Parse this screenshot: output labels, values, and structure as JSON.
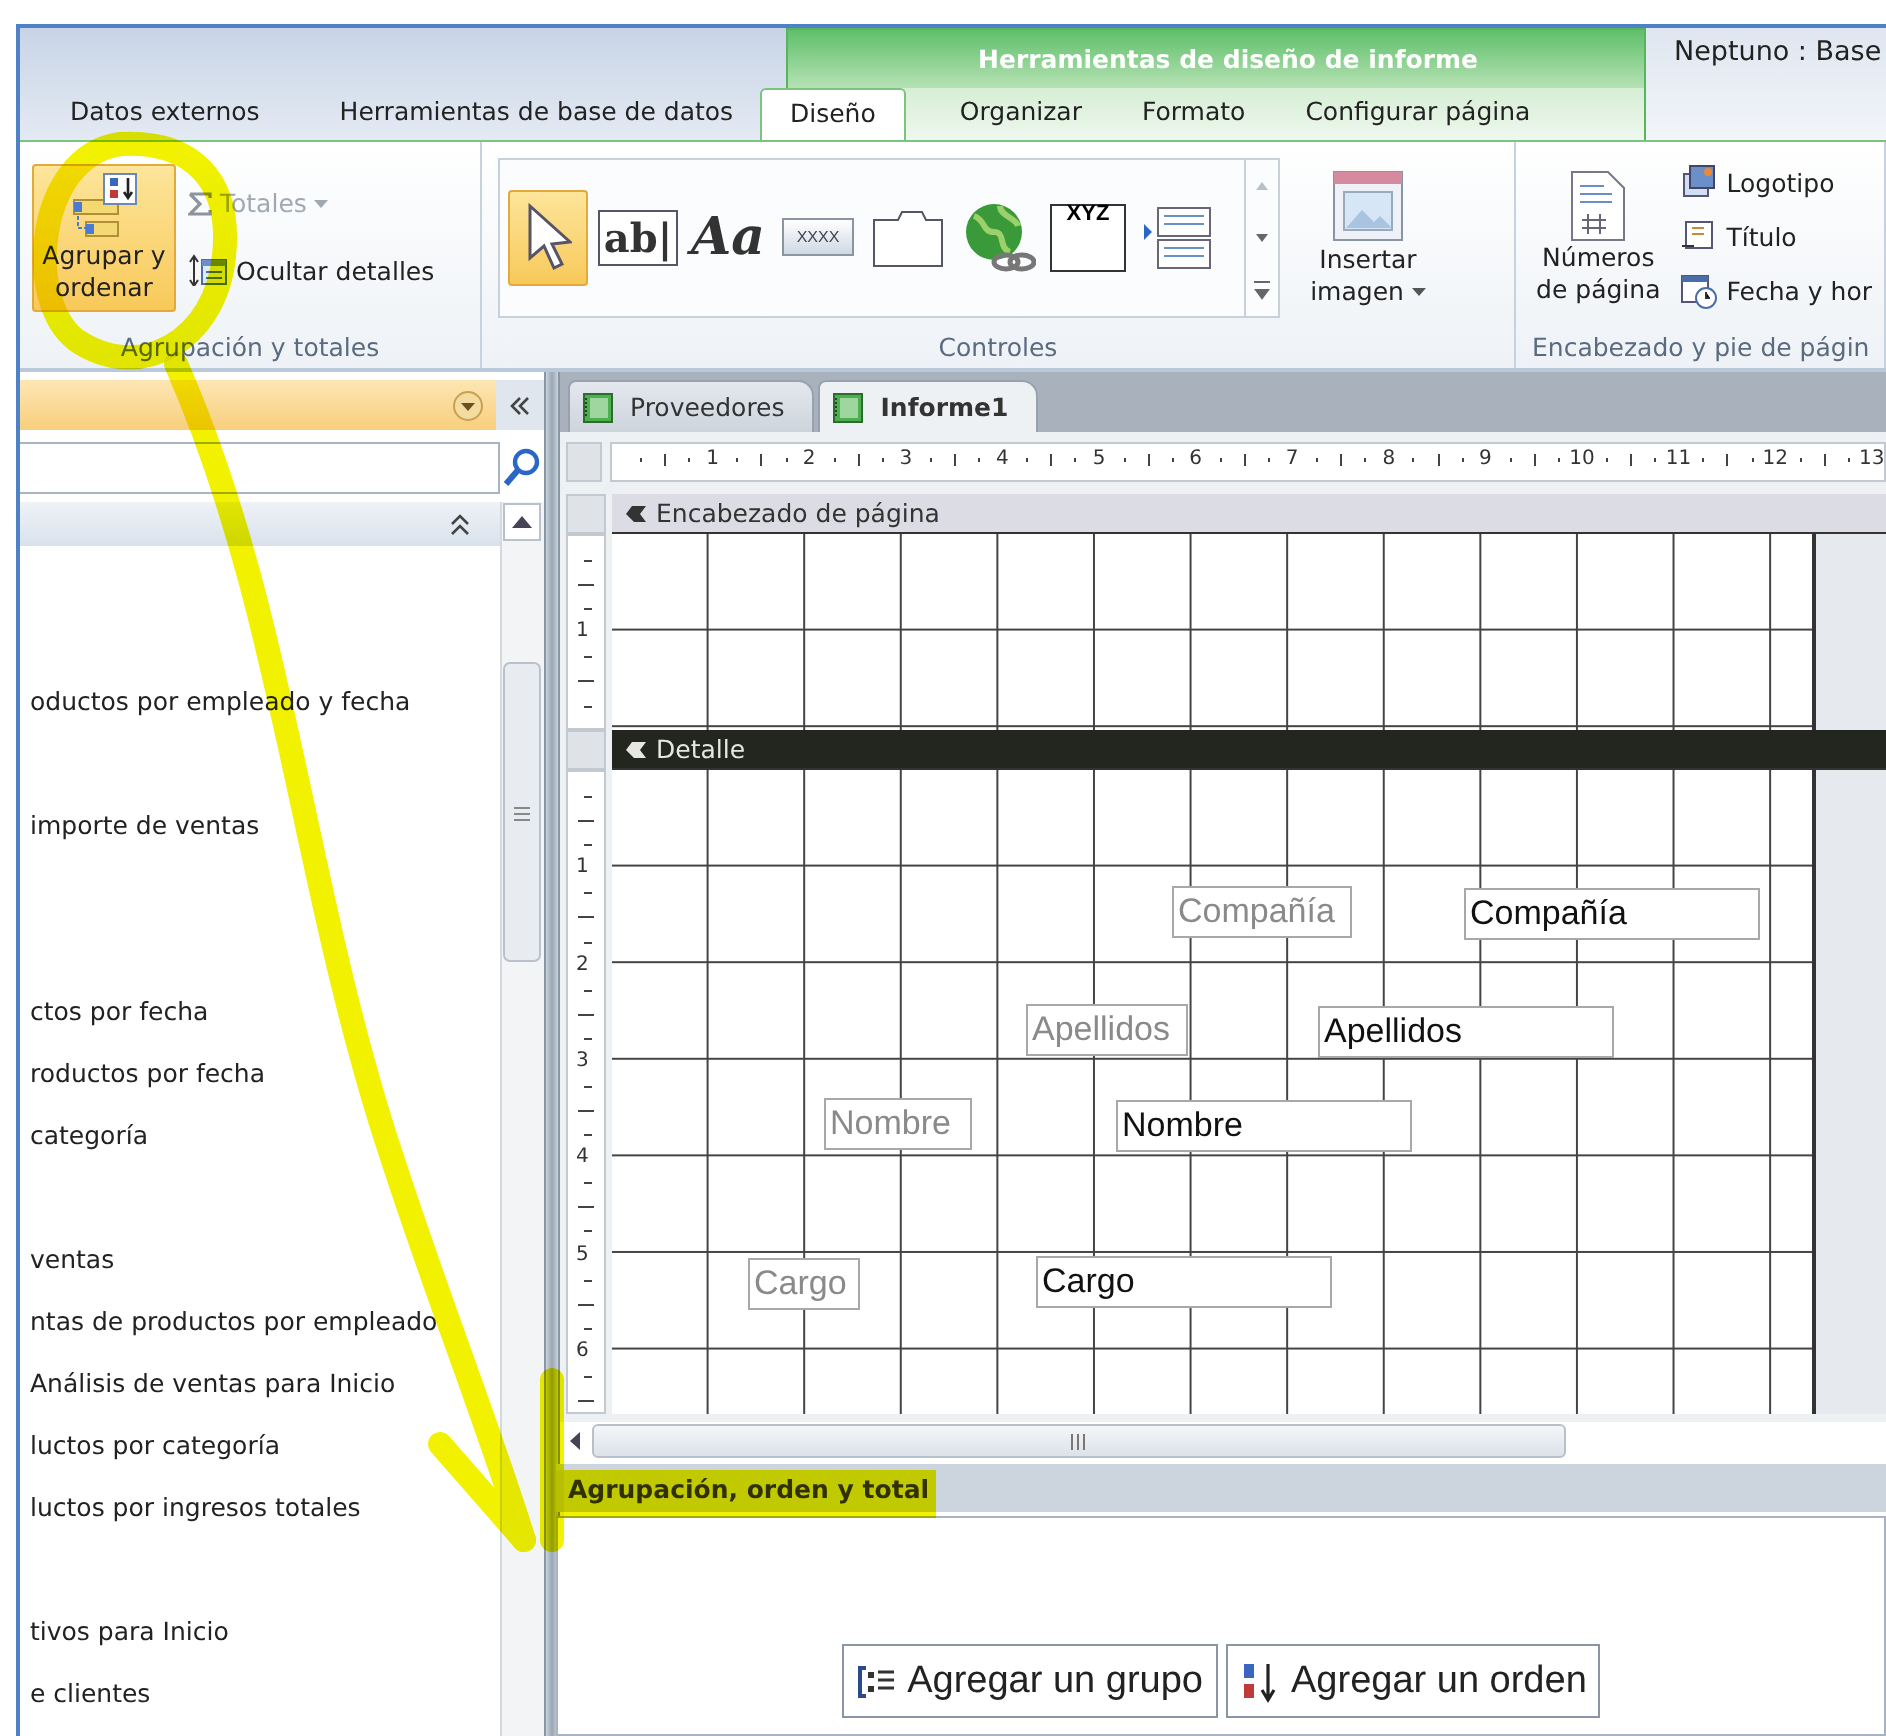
{
  "window": {
    "title": "Neptuno : Base",
    "context_title": "Herramientas de diseño de informe"
  },
  "tabs": [
    {
      "label": "Datos externos",
      "contextual": false,
      "selected": false
    },
    {
      "label": "Herramientas de base de datos",
      "contextual": false,
      "selected": false
    },
    {
      "label": "Diseño",
      "contextual": true,
      "selected": true
    },
    {
      "label": "Organizar",
      "contextual": true,
      "selected": false
    },
    {
      "label": "Formato",
      "contextual": true,
      "selected": false
    },
    {
      "label": "Configurar página",
      "contextual": true,
      "selected": false
    }
  ],
  "ribbon": {
    "grouping": {
      "label": "Agrupación y totales",
      "main_button": {
        "label": "Agrupar y ordenar",
        "selected": true
      },
      "small_buttons": [
        {
          "kind": "totals",
          "label": "Totales",
          "disabled": true
        },
        {
          "kind": "hide",
          "label": "Ocultar detalles",
          "disabled": false
        }
      ]
    },
    "controls": {
      "label": "Controles",
      "gallery": [
        {
          "kind": "pointer",
          "selected": true
        },
        {
          "kind": "textbox",
          "glyph": "ab|",
          "selected": false
        },
        {
          "kind": "label",
          "glyph": "Aa",
          "selected": false
        },
        {
          "kind": "button",
          "glyph": "XXXX",
          "selected": false
        },
        {
          "kind": "tab",
          "selected": false
        },
        {
          "kind": "hyperlink",
          "selected": false
        },
        {
          "kind": "frame",
          "glyph": "XYZ",
          "selected": false
        },
        {
          "kind": "list",
          "selected": false
        }
      ],
      "insert_image": "Insertar imagen"
    },
    "header_footer": {
      "label": "Encabezado y pie de págin",
      "page_numbers": "Números de página",
      "small_buttons": [
        {
          "kind": "logo",
          "label": "Logotipo"
        },
        {
          "kind": "title",
          "label": "Título"
        },
        {
          "kind": "datetime",
          "label": "Fecha y hor"
        }
      ]
    }
  },
  "nav_pane": {
    "items": [
      "oductos por empleado y fecha",
      "importe de ventas",
      "ctos por fecha",
      "roductos por fecha",
      "categoría",
      "ventas",
      "ntas de productos por empleado",
      "Análisis de ventas para Inicio",
      "luctos por categoría",
      "luctos por ingresos totales",
      "tivos para Inicio",
      "e clientes"
    ]
  },
  "document_tabs": [
    {
      "label": "Proveedores",
      "selected": false
    },
    {
      "label": "Informe1",
      "selected": true
    }
  ],
  "ruler": {
    "horizontal": [
      "1",
      "2",
      "3",
      "4",
      "5",
      "6",
      "7",
      "8",
      "9",
      "10",
      "11",
      "12",
      "13"
    ]
  },
  "sections": [
    {
      "kind": "page_header",
      "title": "Encabezado de página",
      "ruler": [
        "1"
      ]
    },
    {
      "kind": "detail",
      "title": "Detalle",
      "ruler": [
        "1",
        "2",
        "3",
        "4",
        "5",
        "6"
      ]
    }
  ],
  "detail_fields": [
    {
      "label": "Compañía",
      "textbox": "Compañía"
    },
    {
      "label": "Apellidos",
      "textbox": "Apellidos"
    },
    {
      "label": "Nombre",
      "textbox": "Nombre"
    },
    {
      "label": "Cargo",
      "textbox": "Cargo"
    }
  ],
  "group_panel": {
    "title": "Agrupación, orden y total",
    "buttons": [
      {
        "kind": "group",
        "label": "Agregar un grupo"
      },
      {
        "kind": "sort",
        "label": "Agregar un orden"
      }
    ]
  }
}
